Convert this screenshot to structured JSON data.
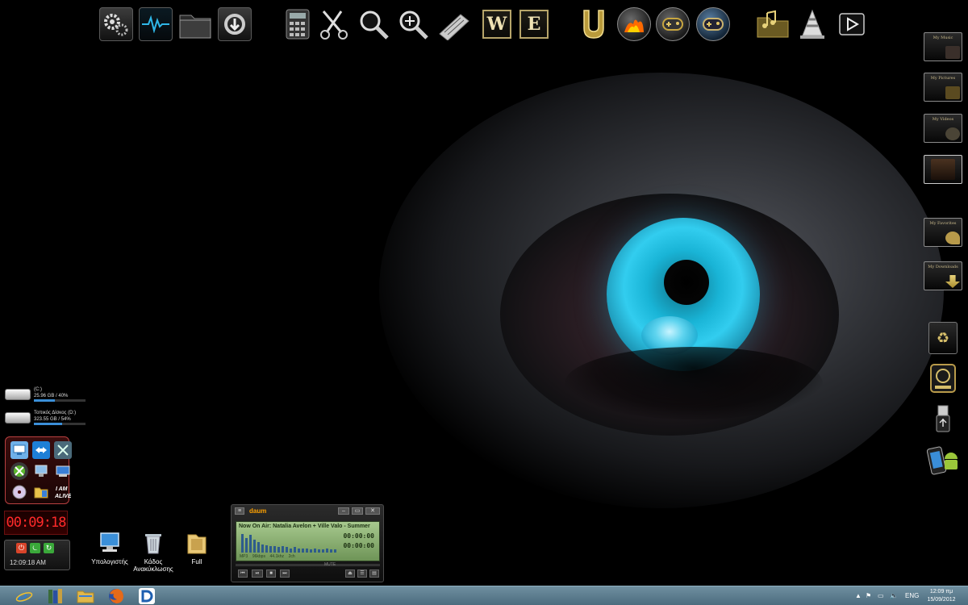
{
  "desktop": {
    "wallpaper": "blue eye",
    "icons": [
      {
        "label": "Υπολογιστής",
        "icon": "computer-icon"
      },
      {
        "label": "Κάδος\nΑνακύκλωσης",
        "icon": "recycle-bin-icon"
      },
      {
        "label": "Full",
        "icon": "folder-icon"
      }
    ]
  },
  "top_dock": {
    "items": [
      {
        "name": "settings-gears-icon"
      },
      {
        "name": "system-monitor-icon"
      },
      {
        "name": "folder-icon"
      },
      {
        "name": "downloads-icon"
      },
      {
        "name": "calculator-icon"
      },
      {
        "name": "scissors-icon"
      },
      {
        "name": "search-icon"
      },
      {
        "name": "zoom-in-icon"
      },
      {
        "name": "keyboard-icon"
      },
      {
        "name": "word-icon",
        "letter": "W"
      },
      {
        "name": "excel-icon",
        "letter": "E"
      },
      {
        "name": "utorrent-icon"
      },
      {
        "name": "burner-icon"
      },
      {
        "name": "game-controller-icon"
      },
      {
        "name": "game-controller-blue-icon"
      },
      {
        "name": "music-folder-icon"
      },
      {
        "name": "vlc-cone-icon"
      },
      {
        "name": "play-icon"
      }
    ]
  },
  "right_dock": {
    "items": [
      {
        "label": "My Music",
        "badge": "music-icon"
      },
      {
        "label": "My Pictures",
        "badge": "pictures-icon"
      },
      {
        "label": "My Videos",
        "badge": "film-reel-icon"
      },
      {
        "label": "",
        "badge": "film-strip-icon"
      },
      {
        "label": "My Favorites",
        "badge": "heart-icon"
      },
      {
        "label": "My Downloads",
        "badge": "download-arrow-icon"
      },
      {
        "label": "",
        "badge": "recycle-icon"
      },
      {
        "label": "",
        "badge": "hard-drive-icon"
      },
      {
        "label": "",
        "badge": "usb-icon"
      },
      {
        "label": "",
        "badge": "android-phone-icon"
      }
    ]
  },
  "drives": [
    {
      "label": "(C:)",
      "stats": "25.96 GB / 40%",
      "usage": 0.4
    },
    {
      "label": "Τοπικός Δίσκος (D:)",
      "stats": "323.55 GB / 54%",
      "usage": 0.54
    }
  ],
  "launcher": {
    "icons": [
      "remote-desktop-icon",
      "teamviewer-icon",
      "network-tools-icon",
      "xbox-icon",
      "computer-icon",
      "monitor-icon",
      "dvd-icon",
      "folder-icon",
      "i-am-alive-icon"
    ]
  },
  "clock_gadget": {
    "timer": "00:09:18"
  },
  "shutdown_gadget": {
    "time": "12:09:18 AM"
  },
  "player": {
    "logo": "daum",
    "now_playing": "Now On Air: Natalia Avelon + Ville Valo - Summer",
    "time_elapsed": "00:00:00",
    "time_total": "00:00:00",
    "format": "MP3",
    "bitrate": "96kbps",
    "samplerate": "44.1khz",
    "channels": "2ch",
    "mute_label": "MUTE",
    "eq_levels": [
      0.9,
      0.7,
      0.85,
      0.6,
      0.5,
      0.4,
      0.35,
      0.3,
      0.3,
      0.25,
      0.3,
      0.25,
      0.2,
      0.25,
      0.2,
      0.2,
      0.2,
      0.15,
      0.2,
      0.15,
      0.15,
      0.2,
      0.15,
      0.15
    ]
  },
  "taskbar": {
    "apps": [
      {
        "name": "internet-explorer-icon",
        "color": "#2a7fd8"
      },
      {
        "name": "books-icon",
        "color": "#3a6b3a"
      },
      {
        "name": "file-explorer-icon",
        "color": "#e0b74a"
      },
      {
        "name": "firefox-icon",
        "color": "#e46a1a"
      },
      {
        "name": "daum-icon",
        "color": "#1e5fb0"
      }
    ],
    "tray": {
      "language": "ENG",
      "time": "12:09 πμ",
      "date": "15/09/2012"
    }
  }
}
